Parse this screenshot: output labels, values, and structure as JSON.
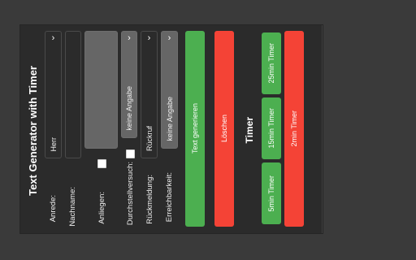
{
  "app": {
    "title": "Text Generator with Timer"
  },
  "form": {
    "anrede": {
      "label": "Anrede:",
      "value": "Herr"
    },
    "nachname": {
      "label": "Nachname:",
      "value": ""
    },
    "anliegen": {
      "label": "Anliegen:",
      "value": ""
    },
    "durchstellversuch": {
      "label": "Durchstellversuch:",
      "checked": false,
      "value": "keine Angabe"
    },
    "rueckmeldung": {
      "label": "Rückmeldung:",
      "value": "Rückruf"
    },
    "erreichbarkeit": {
      "label": "Erreichbarkeit:",
      "value": "keine Angabe"
    }
  },
  "buttons": {
    "generate": "Text generieren",
    "delete": "Löschen"
  },
  "timer": {
    "title": "Timer",
    "presets": [
      "5min Timer",
      "15min Timer",
      "25min Timer"
    ],
    "red_button": "2min Timer"
  },
  "colors": {
    "background": "#3a3a3a",
    "panel": "#2b2b2b",
    "green": "#4caf50",
    "red": "#f44336"
  },
  "icons": {
    "dropdown": "chevron-down-icon"
  }
}
